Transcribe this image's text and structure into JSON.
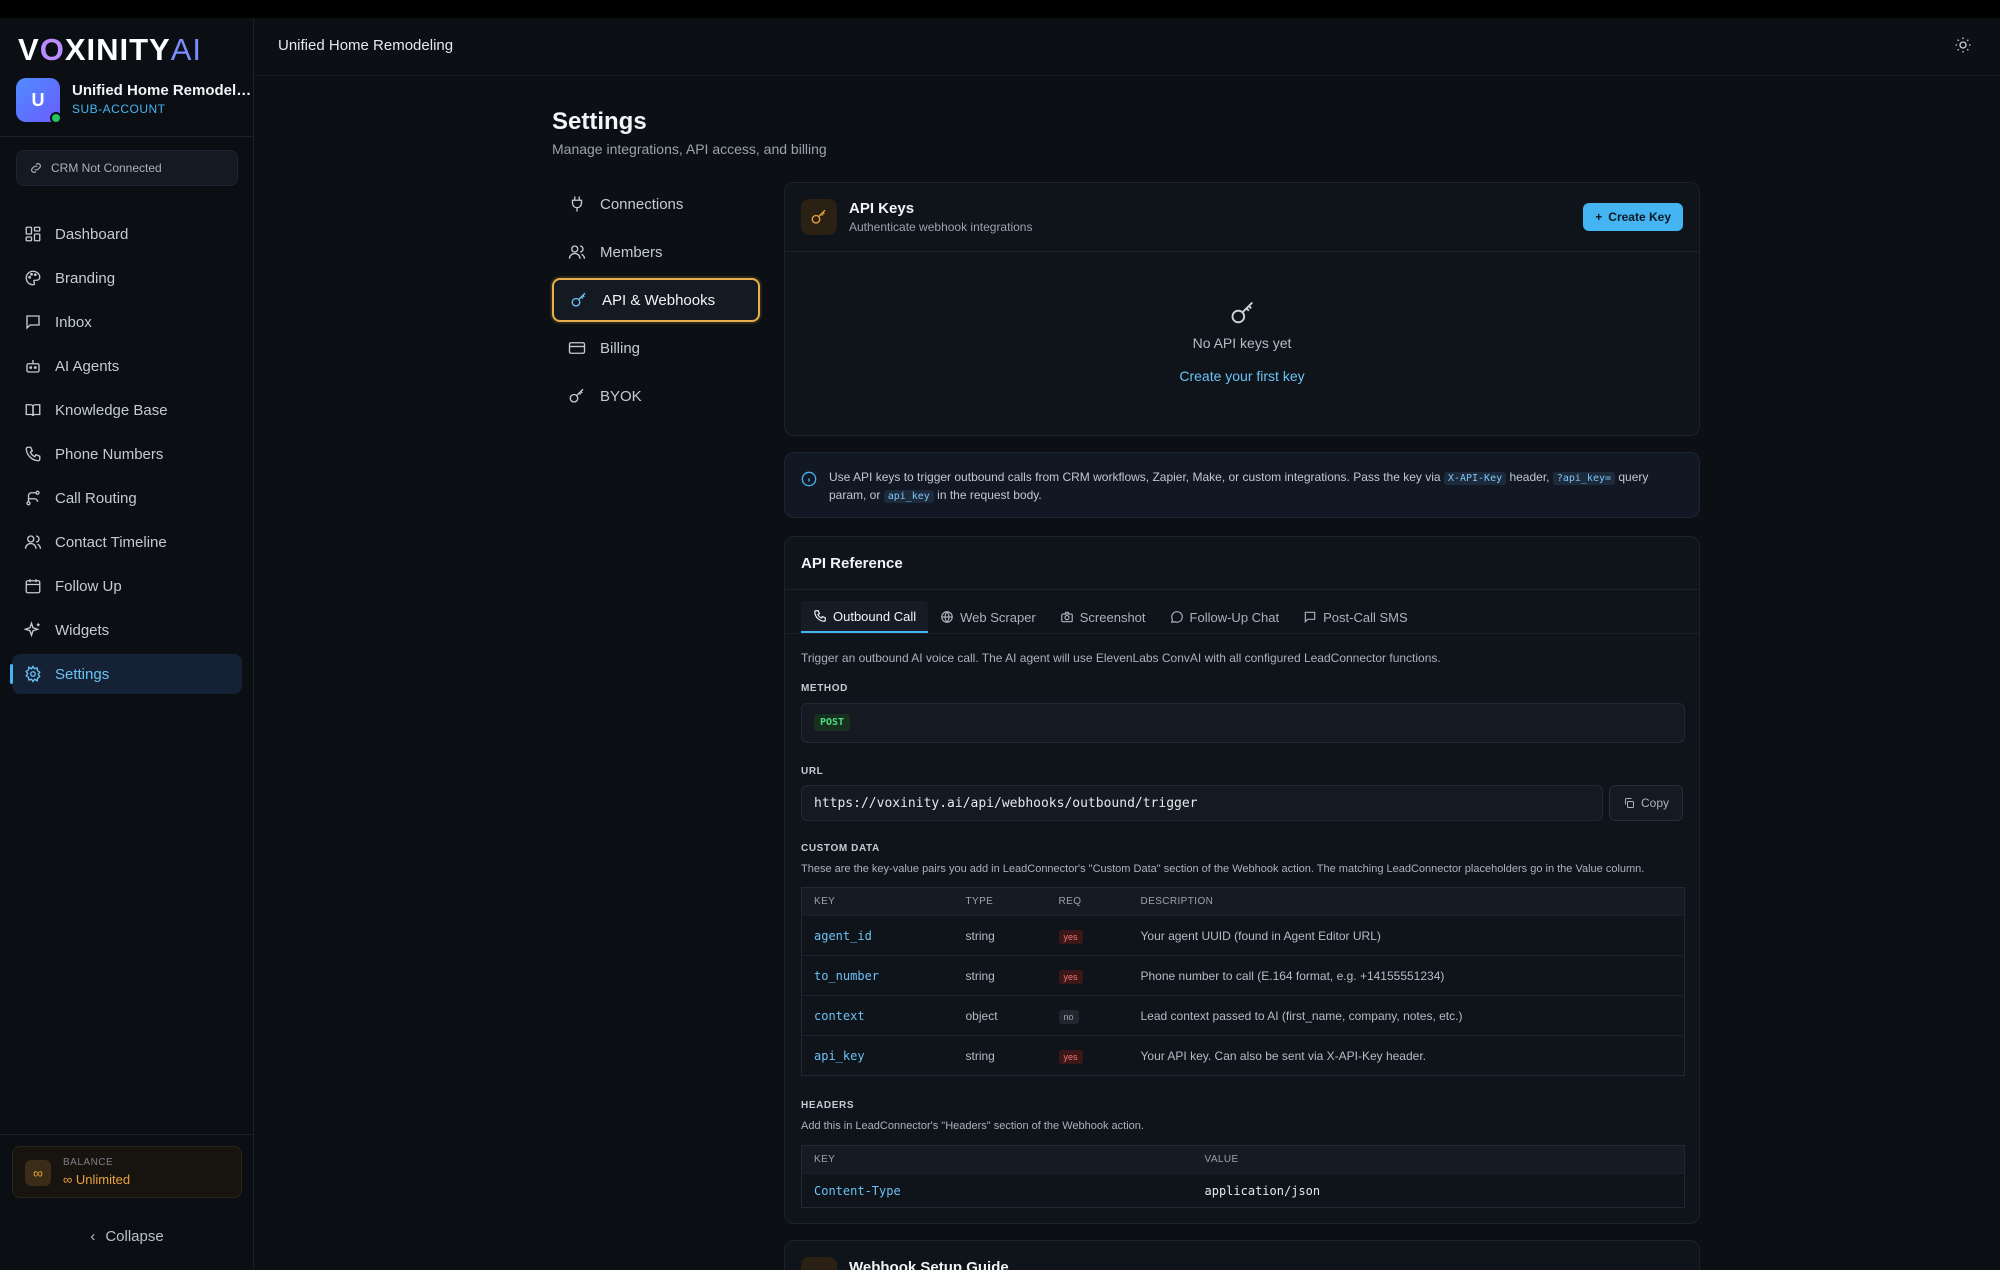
{
  "brand": {
    "logo_main": "V",
    "logo_rest": "XINITY",
    "logo_ai": "AI",
    "logo_o": "O"
  },
  "account": {
    "initial": "U",
    "name": "Unified Home Remodeli...",
    "role": "SUB-ACCOUNT"
  },
  "crm_status": "CRM Not Connected",
  "nav": [
    {
      "label": "Dashboard",
      "icon": "dashboard-icon"
    },
    {
      "label": "Branding",
      "icon": "palette-icon"
    },
    {
      "label": "Inbox",
      "icon": "inbox-icon"
    },
    {
      "label": "AI Agents",
      "icon": "robot-icon"
    },
    {
      "label": "Knowledge Base",
      "icon": "book-icon"
    },
    {
      "label": "Phone Numbers",
      "icon": "phone-icon"
    },
    {
      "label": "Call Routing",
      "icon": "routing-icon"
    },
    {
      "label": "Contact Timeline",
      "icon": "contacts-icon"
    },
    {
      "label": "Follow Up",
      "icon": "calendar-icon"
    },
    {
      "label": "Widgets",
      "icon": "sparkles-icon"
    },
    {
      "label": "Settings",
      "icon": "gear-icon",
      "active": true
    }
  ],
  "balance": {
    "label": "BALANCE",
    "value": "Unlimited",
    "symbol": "∞"
  },
  "collapse_label": "Collapse",
  "header": {
    "title": "Unified Home Remodeling"
  },
  "page": {
    "title": "Settings",
    "subtitle": "Manage integrations, API access, and billing"
  },
  "settings_nav": [
    {
      "label": "Connections",
      "icon": "plug-icon"
    },
    {
      "label": "Members",
      "icon": "users-icon"
    },
    {
      "label": "API & Webhooks",
      "icon": "key-icon",
      "active": true
    },
    {
      "label": "Billing",
      "icon": "credit-card-icon"
    },
    {
      "label": "BYOK",
      "icon": "key-icon"
    }
  ],
  "api_keys": {
    "title": "API Keys",
    "subtitle": "Authenticate webhook integrations",
    "create_label": "Create Key",
    "empty_text": "No API keys yet",
    "empty_link": "Create your first key"
  },
  "info": {
    "part1": "Use API keys to trigger outbound calls from CRM workflows, Zapier, Make, or custom integrations. Pass the key via ",
    "code1": "X-API-Key",
    "part2": " header, ",
    "code2": "?api_key=",
    "part3": " query param, or ",
    "code3": "api_key",
    "part4": " in the request body."
  },
  "api_reference": {
    "title": "API Reference",
    "tabs": [
      "Outbound Call",
      "Web Scraper",
      "Screenshot",
      "Follow-Up Chat",
      "Post-Call SMS"
    ],
    "description": "Trigger an outbound AI voice call. The AI agent will use ElevenLabs ConvAI with all configured LeadConnector functions.",
    "method_label": "METHOD",
    "method": "POST",
    "url_label": "URL",
    "url": "https://voxinity.ai/api/webhooks/outbound/trigger",
    "copy_label": "Copy",
    "custom_data_label": "CUSTOM DATA",
    "custom_data_desc": "These are the key-value pairs you add in LeadConnector's \"Custom Data\" section of the Webhook action. The matching LeadConnector placeholders go in the Value column.",
    "custom_columns": [
      "KEY",
      "TYPE",
      "REQ",
      "DESCRIPTION"
    ],
    "custom_rows": [
      {
        "key": "agent_id",
        "type": "string",
        "req": "yes",
        "desc": "Your agent UUID (found in Agent Editor URL)"
      },
      {
        "key": "to_number",
        "type": "string",
        "req": "yes",
        "desc": "Phone number to call (E.164 format, e.g. +14155551234)"
      },
      {
        "key": "context",
        "type": "object",
        "req": "no",
        "desc": "Lead context passed to AI (first_name, company, notes, etc.)"
      },
      {
        "key": "api_key",
        "type": "string",
        "req": "yes",
        "desc": "Your API key. Can also be sent via X-API-Key header."
      }
    ],
    "headers_label": "HEADERS",
    "headers_desc": "Add this in LeadConnector's \"Headers\" section of the Webhook action.",
    "header_columns": [
      "KEY",
      "VALUE"
    ],
    "header_rows": [
      {
        "key": "Content-Type",
        "value": "application/json"
      }
    ]
  },
  "guide": {
    "title": "Webhook Setup Guide"
  }
}
